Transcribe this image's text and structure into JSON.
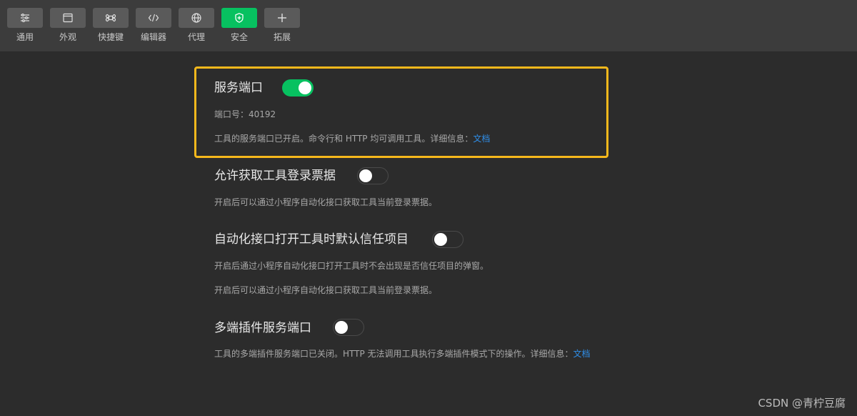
{
  "toolbar": {
    "items": [
      {
        "label": "通用",
        "icon": "sliders-icon",
        "active": false
      },
      {
        "label": "外观",
        "icon": "window-icon",
        "active": false
      },
      {
        "label": "快捷键",
        "icon": "command-icon",
        "active": false
      },
      {
        "label": "编辑器",
        "icon": "code-icon",
        "active": false
      },
      {
        "label": "代理",
        "icon": "globe-icon",
        "active": false
      },
      {
        "label": "安全",
        "icon": "shield-icon",
        "active": true
      },
      {
        "label": "拓展",
        "icon": "plus-icon",
        "active": false
      }
    ]
  },
  "sections": {
    "service_port": {
      "title": "服务端口",
      "enabled": true,
      "port_label": "端口号：40192",
      "desc_text": "工具的服务端口已开启。命令行和 HTTP 均可调用工具。详细信息：",
      "link": "文档"
    },
    "login_ticket": {
      "title": "允许获取工具登录票据",
      "enabled": false,
      "desc": "开启后可以通过小程序自动化接口获取工具当前登录票据。"
    },
    "auto_trust": {
      "title": "自动化接口打开工具时默认信任项目",
      "enabled": false,
      "desc1": "开启后通过小程序自动化接口打开工具时不会出现是否信任项目的弹窗。",
      "desc2": "开启后可以通过小程序自动化接口获取工具当前登录票据。"
    },
    "multi_port": {
      "title": "多端插件服务端口",
      "enabled": false,
      "desc_text": "工具的多端插件服务端口已关闭。HTTP 无法调用工具执行多端插件模式下的操作。详细信息：",
      "link": "文档"
    }
  },
  "watermark": "CSDN @青柠豆腐",
  "colors": {
    "background": "#2c2c2c",
    "toolbar": "#3c3c3c",
    "accent_green": "#07c160",
    "highlight": "#f5b81c",
    "link": "#2f8ee8"
  }
}
